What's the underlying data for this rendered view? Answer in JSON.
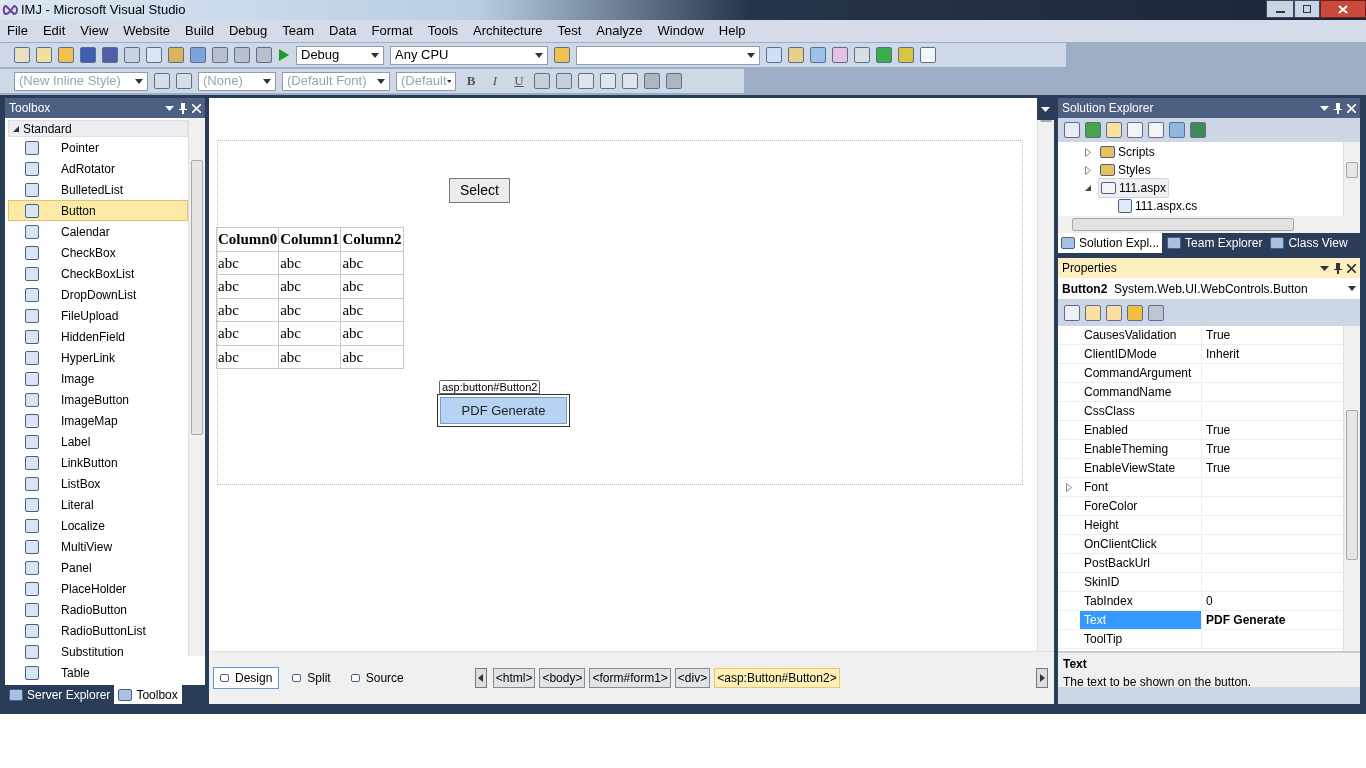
{
  "window": {
    "title": "IMJ - Microsoft Visual Studio"
  },
  "menu": [
    "File",
    "Edit",
    "View",
    "Website",
    "Build",
    "Debug",
    "Team",
    "Data",
    "Format",
    "Tools",
    "Architecture",
    "Test",
    "Analyze",
    "Window",
    "Help"
  ],
  "toolbar": {
    "configuration": "Debug",
    "platform": "Any CPU"
  },
  "format_toolbar": {
    "style": "(New Inline Style)",
    "block": "(None)",
    "font": "(Default Font)",
    "size": "(Default",
    "buttons": [
      "B",
      "I",
      "U"
    ]
  },
  "toolbox": {
    "title": "Toolbox",
    "group": "Standard",
    "items": [
      {
        "label": "Pointer",
        "selected": false
      },
      {
        "label": "AdRotator",
        "selected": false
      },
      {
        "label": "BulletedList",
        "selected": false
      },
      {
        "label": "Button",
        "selected": true
      },
      {
        "label": "Calendar",
        "selected": false
      },
      {
        "label": "CheckBox",
        "selected": false
      },
      {
        "label": "CheckBoxList",
        "selected": false
      },
      {
        "label": "DropDownList",
        "selected": false
      },
      {
        "label": "FileUpload",
        "selected": false
      },
      {
        "label": "HiddenField",
        "selected": false
      },
      {
        "label": "HyperLink",
        "selected": false
      },
      {
        "label": "Image",
        "selected": false
      },
      {
        "label": "ImageButton",
        "selected": false
      },
      {
        "label": "ImageMap",
        "selected": false
      },
      {
        "label": "Label",
        "selected": false
      },
      {
        "label": "LinkButton",
        "selected": false
      },
      {
        "label": "ListBox",
        "selected": false
      },
      {
        "label": "Literal",
        "selected": false
      },
      {
        "label": "Localize",
        "selected": false
      },
      {
        "label": "MultiView",
        "selected": false
      },
      {
        "label": "Panel",
        "selected": false
      },
      {
        "label": "PlaceHolder",
        "selected": false
      },
      {
        "label": "RadioButton",
        "selected": false
      },
      {
        "label": "RadioButtonList",
        "selected": false
      },
      {
        "label": "Substitution",
        "selected": false
      },
      {
        "label": "Table",
        "selected": false
      }
    ],
    "tabs": [
      {
        "label": "Server Explorer",
        "selected": false
      },
      {
        "label": "Toolbox",
        "selected": true
      }
    ]
  },
  "designer": {
    "select_button": "Select",
    "table": {
      "columns": [
        "Column0",
        "Column1",
        "Column2"
      ],
      "rows": [
        [
          "abc",
          "abc",
          "abc"
        ],
        [
          "abc",
          "abc",
          "abc"
        ],
        [
          "abc",
          "abc",
          "abc"
        ],
        [
          "abc",
          "abc",
          "abc"
        ],
        [
          "abc",
          "abc",
          "abc"
        ]
      ]
    },
    "selected_tag": "asp:button#Button2",
    "pdf_button": "PDF Generate",
    "view_tabs": [
      {
        "label": "Design",
        "selected": true
      },
      {
        "label": "Split",
        "selected": false
      },
      {
        "label": "Source",
        "selected": false
      }
    ],
    "breadcrumbs": [
      {
        "label": "<html>",
        "selected": false
      },
      {
        "label": "<body>",
        "selected": false
      },
      {
        "label": "<form#form1>",
        "selected": false
      },
      {
        "label": "<div>",
        "selected": false
      },
      {
        "label": "<asp:Button#Button2>",
        "selected": true
      }
    ]
  },
  "solution_explorer": {
    "title": "Solution Explorer",
    "tree": [
      {
        "label": "Scripts",
        "kind": "folder",
        "expanded": false,
        "selected": false
      },
      {
        "label": "Styles",
        "kind": "folder",
        "expanded": false,
        "selected": false
      },
      {
        "label": "111.aspx",
        "kind": "page",
        "expanded": true,
        "selected": true,
        "children": [
          {
            "label": "111.aspx.cs",
            "kind": "code",
            "selected": false
          }
        ]
      }
    ],
    "tabs": [
      {
        "label": "Solution Expl...",
        "selected": true
      },
      {
        "label": "Team Explorer",
        "selected": false
      },
      {
        "label": "Class View",
        "selected": false
      }
    ]
  },
  "properties": {
    "title": "Properties",
    "object": "Button2",
    "type": "System.Web.UI.WebControls.Button",
    "rows": [
      {
        "name": "CausesValidation",
        "value": "True",
        "selected": false
      },
      {
        "name": "ClientIDMode",
        "value": "Inherit",
        "selected": false
      },
      {
        "name": "CommandArgument",
        "selected": false
      },
      {
        "name": "CommandName",
        "selected": false
      },
      {
        "name": "CssClass",
        "selected": false
      },
      {
        "name": "Enabled",
        "value": "True",
        "selected": false
      },
      {
        "name": "EnableTheming",
        "value": "True",
        "selected": false
      },
      {
        "name": "EnableViewState",
        "value": "True",
        "selected": false
      },
      {
        "name": "Font",
        "selected": false,
        "expanded": false
      },
      {
        "name": "ForeColor",
        "selected": false
      },
      {
        "name": "Height",
        "selected": false
      },
      {
        "name": "OnClientClick",
        "selected": false
      },
      {
        "name": "PostBackUrl",
        "selected": false
      },
      {
        "name": "SkinID",
        "selected": false
      },
      {
        "name": "TabIndex",
        "value": "0",
        "selected": false
      },
      {
        "name": "Text",
        "value": "PDF Generate",
        "selected": true
      },
      {
        "name": "ToolTip",
        "selected": false
      }
    ],
    "description_title": "Text",
    "description": "The text to be shown on the button."
  }
}
